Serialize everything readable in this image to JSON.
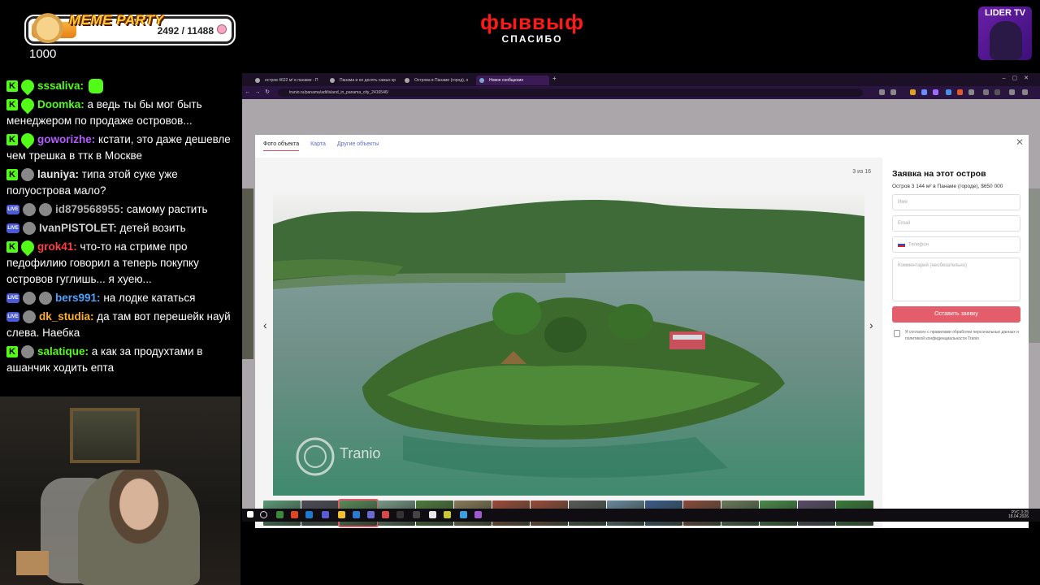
{
  "overlay": {
    "party_title": "MEME PARTY",
    "party_count": "2492 / 11488",
    "party_progress": 0.22,
    "counter": "1000",
    "brand_title": "фыввыф",
    "brand_subtitle": "СПАСИБО",
    "channel_badge": "LIDER TV"
  },
  "chat": [
    {
      "badges": [
        "k",
        "heart"
      ],
      "user": "sssaliva:",
      "color": "#53fc18",
      "text": ""
    },
    {
      "badges": [
        "k",
        "heart"
      ],
      "user": "Doomka:",
      "color": "#53fc18",
      "text": "а ведь ты бы мог быть менеджером по продаже островов..."
    },
    {
      "badges": [
        "k",
        "heart"
      ],
      "user": "goworizhe:",
      "color": "#b45cff",
      "text": "кстати, это даже дешевле чем трешка в ттк в Москве"
    },
    {
      "badges": [
        "k",
        "av"
      ],
      "user": "launiya:",
      "color": "#e8e8e8",
      "text": "типа этой суке уже полуострова мало?"
    },
    {
      "badges": [
        "live",
        "av",
        "av"
      ],
      "user": "id879568955:",
      "color": "#b0b0b0",
      "text": "самому растить"
    },
    {
      "badges": [
        "live",
        "av"
      ],
      "user": "IvanPISTOLET:",
      "color": "#d0d0d0",
      "text": "детей возить"
    },
    {
      "badges": [
        "k",
        "heart"
      ],
      "user": "grok41:",
      "color": "#ff4040",
      "text": "что-то на стриме про педофилию говорил а теперь покупку островов гуглишь... я хуею..."
    },
    {
      "badges": [
        "live",
        "av",
        "av"
      ],
      "user": "bers991:",
      "color": "#4aa3ff",
      "text": "на лодке кататься"
    },
    {
      "badges": [
        "live",
        "av"
      ],
      "user": "dk_studia:",
      "color": "#ffb020",
      "text": "да там вот перешейк науй слева. Наебка"
    },
    {
      "badges": [
        "k",
        "av"
      ],
      "user": "salatique:",
      "color": "#53fc18",
      "text": "а как за продухтами в ашанчик ходить епта"
    }
  ],
  "browser": {
    "tabs": [
      {
        "label": "остров 4622 м² в панаме - П"
      },
      {
        "label": "Панама и ее десять самых кр"
      },
      {
        "label": "Острова в Панаме (город), о"
      },
      {
        "label": "Новое сообщение"
      }
    ],
    "url": "tranio.ru/panama/adt/island_in_panama_city_2416546/"
  },
  "modal": {
    "tabs": [
      "Фото объекта",
      "Карта",
      "Другие объекты"
    ],
    "photo_counter": "3 из 16",
    "watermark": "Tranio",
    "form_title": "Заявка на этот остров",
    "form_subtitle": "Остров 3 144 м² в Панаме (городе), $650 000",
    "name_placeholder": "Имя",
    "email_placeholder": "Email",
    "phone_placeholder": "Телефон",
    "comment_placeholder": "Комментарий (необязательно)",
    "submit_label": "Оставить заявку",
    "agree_text": "Я согласен с правилами обработки персональных данных и политикой конфиденциальности Tranio"
  },
  "taskbar": {
    "time": "3:25",
    "date": "18.04.2026",
    "lang": "РУС"
  },
  "colors": {
    "accent": "#e35d6a",
    "link": "#5a6fd0",
    "kick_green": "#53fc18",
    "brand_red": "#ff1a1a"
  }
}
